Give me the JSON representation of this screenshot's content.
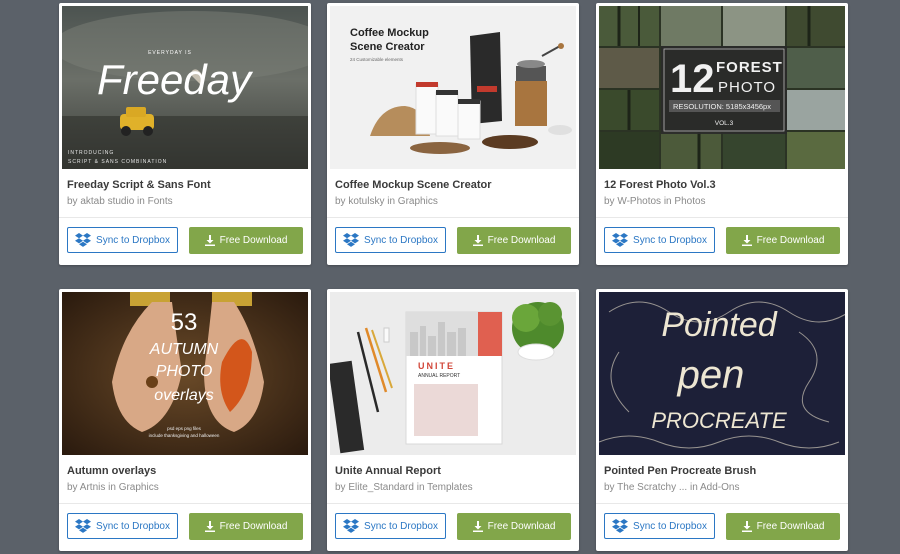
{
  "buttons": {
    "sync_label": "Sync to Dropbox",
    "download_label": "Free Download"
  },
  "colors": {
    "page_bg": "#5b6169",
    "dropbox_blue": "#2b77c4",
    "download_green": "#82a64a"
  },
  "icons": {
    "sync": "dropbox-icon",
    "download": "download-arrow-icon"
  },
  "cards": [
    {
      "title": "Freeday Script & Sans Font",
      "meta": "by aktab studio in Fonts",
      "thumb": {
        "script": "Freeday",
        "small_top": "EVERYDAY IS",
        "caption_1": "INTRODUCING",
        "caption_2": "SCRIPT & SANS COMBINATION"
      }
    },
    {
      "title": "Coffee Mockup Scene Creator",
      "meta": "by kotulsky in Graphics",
      "thumb": {
        "heading_1": "Coffee Mockup",
        "heading_2": "Scene Creator",
        "sub": "24 Customizable elements"
      }
    },
    {
      "title": "12 Forest Photo Vol.3",
      "meta": "by W-Photos in Photos",
      "thumb": {
        "big_number": "12",
        "word_1": "FOREST",
        "word_2": "PHOTO",
        "resolution": "RESOLUTION: 5185x3456px",
        "vol": "VOL.3"
      }
    },
    {
      "title": "Autumn overlays",
      "meta": "by Artnis in Graphics",
      "thumb": {
        "number": "53",
        "line_1": "AUTUMN",
        "line_2": "PHOTO",
        "line_3": "overlays",
        "footnote_1": "psd eps png files",
        "footnote_2": "include thanksgiving and halloween"
      }
    },
    {
      "title": "Unite Annual Report",
      "meta": "by Elite_Standard in Templates",
      "thumb": {
        "heading": "UNITE",
        "sub": "ANNUAL REPORT"
      }
    },
    {
      "title": "Pointed Pen Procreate Brush",
      "meta_author": "by The Scratchy ...",
      "meta_rest": "in Add-Ons",
      "thumb": {
        "line_1": "Pointed",
        "line_2": "pen",
        "line_3": "PROCREATE"
      }
    }
  ]
}
